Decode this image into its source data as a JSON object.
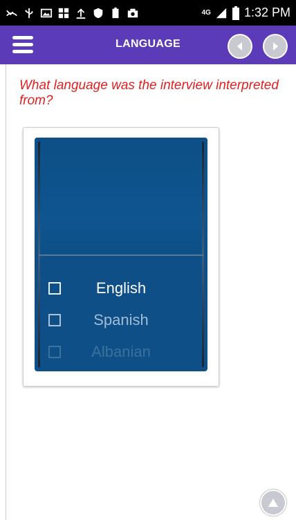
{
  "status_bar": {
    "time": "1:32 PM",
    "network": "4G",
    "icons": [
      "missed-call-icon",
      "usb-icon",
      "image-icon",
      "app-icon",
      "upload-icon",
      "shield-icon",
      "battery-100-icon",
      "camera-icon"
    ]
  },
  "app_bar": {
    "title": "LANGUAGE",
    "prev_icon": "chevron-left-icon",
    "next_icon": "chevron-right-icon",
    "menu_icon": "hamburger-menu-icon",
    "color": "#5b3bb7"
  },
  "question": {
    "text": "What language was the interview interpreted from?",
    "color": "#e02020"
  },
  "picker": {
    "options": [
      {
        "label": "English",
        "checked": false
      },
      {
        "label": "Spanish",
        "checked": false
      },
      {
        "label": "Albanian",
        "checked": false
      }
    ],
    "background": "#0d4f86"
  },
  "scroll_top_icon": "arrow-up-icon"
}
